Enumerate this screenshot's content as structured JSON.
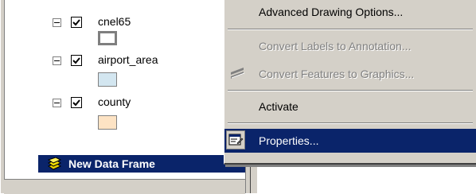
{
  "toc": {
    "layers": [
      {
        "name": "cnel65",
        "checked": true,
        "expanded": true,
        "symbol_fill": "#ffffff",
        "symbol_outline": "#7f7f7f"
      },
      {
        "name": "airport_area",
        "checked": true,
        "expanded": true,
        "symbol_fill": "#d3e6f0",
        "symbol_outline": "#808080"
      },
      {
        "name": "county",
        "checked": true,
        "expanded": true,
        "symbol_fill": "#fde3c4",
        "symbol_outline": "#808080"
      }
    ],
    "data_frame": {
      "name": "New Data Frame",
      "icon": "layers-icon",
      "selected": true
    }
  },
  "context_menu": {
    "items": [
      {
        "label": "Advanced Drawing Options...",
        "enabled": true,
        "icon": null
      },
      {
        "label": "Convert Labels to Annotation...",
        "enabled": false,
        "icon": null
      },
      {
        "label": "Convert Features to Graphics...",
        "enabled": false,
        "icon": "convert-features-icon"
      },
      {
        "label": "Activate",
        "enabled": true,
        "icon": null
      },
      {
        "label": "Properties...",
        "enabled": true,
        "icon": "properties-icon",
        "highlighted": true
      }
    ]
  },
  "colors": {
    "selection": "#0a246a",
    "menu_bg": "#d4d0c8"
  }
}
